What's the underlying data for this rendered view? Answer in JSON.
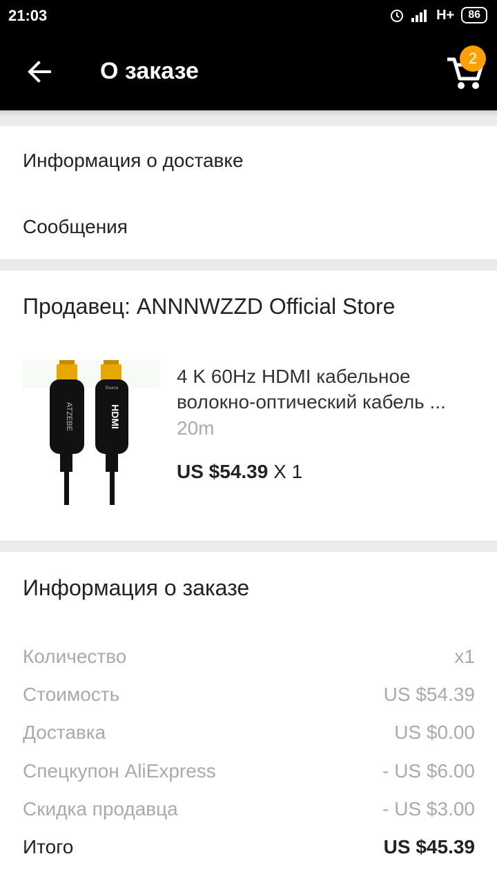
{
  "status_bar": {
    "time": "21:03",
    "network": "H+",
    "battery": "86",
    "icons": [
      "alarm-icon",
      "signal-icon"
    ]
  },
  "app_bar": {
    "title": "О заказе",
    "back_icon": "arrow-left-icon",
    "cart_icon": "cart-icon",
    "cart_count": "2",
    "accent_color": "#ff9f00"
  },
  "links": {
    "delivery_info": "Информация о доставке",
    "messages": "Сообщения"
  },
  "seller": {
    "label": "Продавец: ANNNWZZD Official Store"
  },
  "product": {
    "title_line1": "4 K 60Hz HDMI кабельное",
    "title_line2": "волокно-оптический кабель ...",
    "variant": "20m",
    "price": "US $54.39",
    "quantity": " X 1",
    "image_labels": [
      "ATZEBE",
      "HDMI",
      "Source"
    ]
  },
  "order_info": {
    "title": "Информация о заказе",
    "rows": [
      {
        "label": "Количество",
        "value": "x1"
      },
      {
        "label": "Стоимость",
        "value": "US $54.39"
      },
      {
        "label": "Доставка",
        "value": "US $0.00"
      },
      {
        "label": "Спецкупон AliExpress",
        "value": "- US $6.00"
      },
      {
        "label": "Скидка продавца",
        "value": "- US $3.00"
      },
      {
        "label": "Итого",
        "value": "US $45.39"
      }
    ]
  }
}
